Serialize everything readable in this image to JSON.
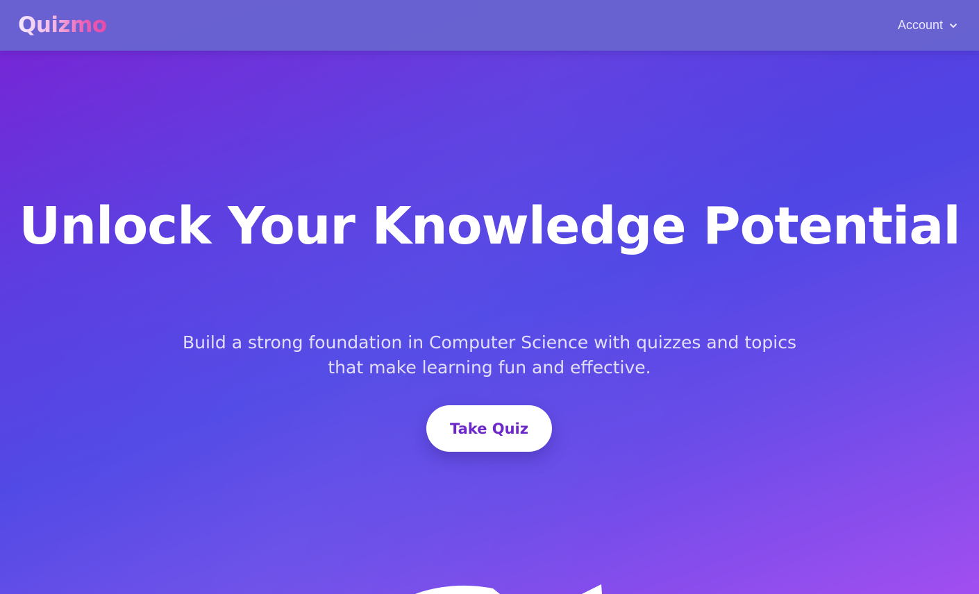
{
  "brand": {
    "name": "Quizmo"
  },
  "nav": {
    "account_label": "Account",
    "account_icon": "chevron-down-icon"
  },
  "hero": {
    "title": "Unlock Your Knowledge Potential",
    "subtitle": "Build a strong foundation in Computer Science with quizzes and topics that make learning fun and effective.",
    "cta_label": "Take Quiz"
  },
  "colors": {
    "gradient_start": "#7b22d4",
    "gradient_mid": "#4f46e5",
    "gradient_end": "#a24ef0",
    "navbar": "#6863d1",
    "logo_accent": "#e84aa8",
    "cta_text": "#6d28c9"
  }
}
